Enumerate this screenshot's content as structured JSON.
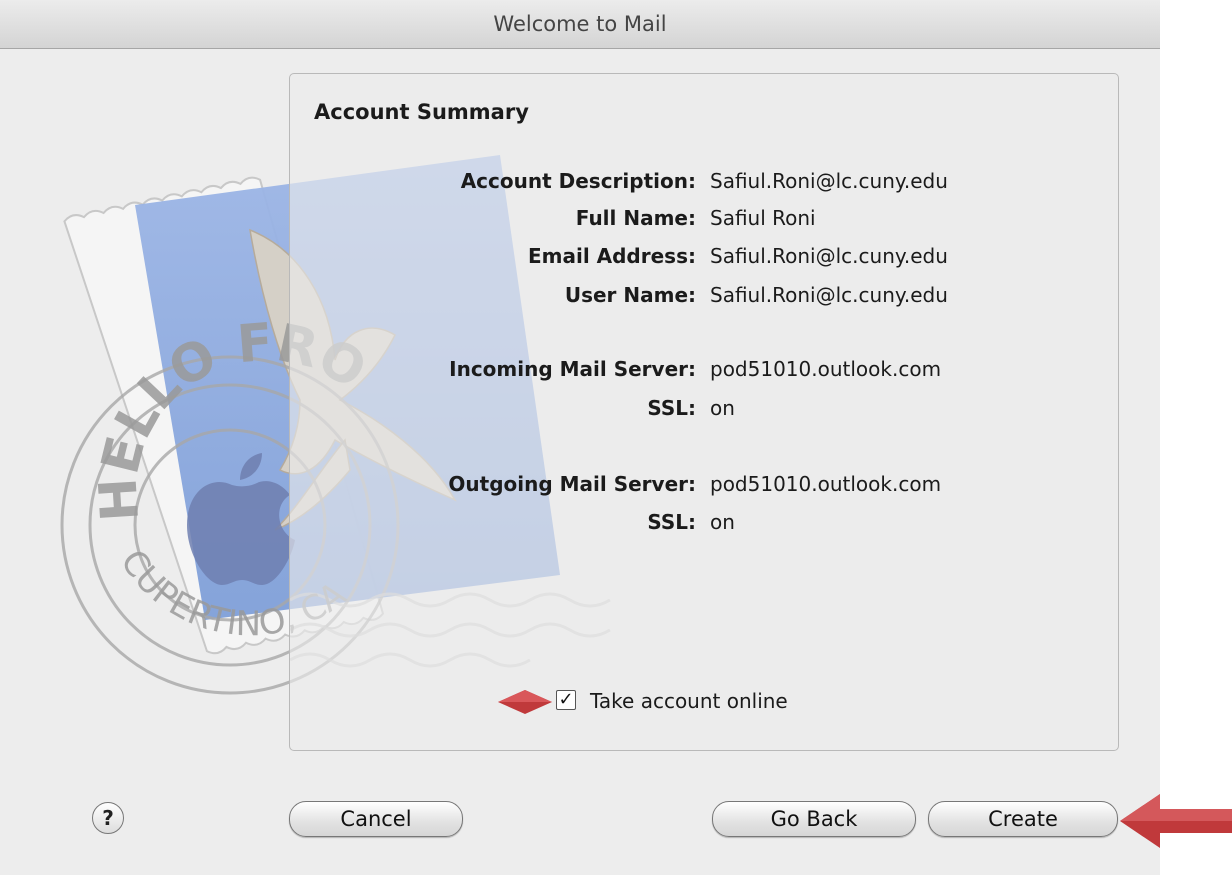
{
  "window": {
    "title": "Welcome to Mail"
  },
  "summary": {
    "title": "Account Summary",
    "rows": [
      {
        "label": "Account Description:",
        "value": "Safiul.Roni@lc.cuny.edu"
      },
      {
        "label": "Full Name:",
        "value": "Safiul Roni"
      },
      {
        "label": "Email Address:",
        "value": "Safiul.Roni@lc.cuny.edu"
      },
      {
        "label": "User Name:",
        "value": "Safiul.Roni@lc.cuny.edu"
      },
      {
        "label": "Incoming Mail Server:",
        "value": "pod51010.outlook.com"
      },
      {
        "label": "SSL:",
        "value": "on"
      },
      {
        "label": "Outgoing Mail Server:",
        "value": "pod51010.outlook.com"
      },
      {
        "label": "SSL:",
        "value": "on"
      }
    ]
  },
  "take_online": {
    "label": "Take account online",
    "checked": true,
    "check_glyph": "✓"
  },
  "stamp": {
    "top_text": "HELLO FROM",
    "bottom_text": "CUPERTINO, CA"
  },
  "buttons": {
    "help": "?",
    "cancel": "Cancel",
    "go_back": "Go Back",
    "create": "Create"
  },
  "colors": {
    "annotation_red": "#c0393b"
  },
  "icons": [
    "help-icon",
    "checkbox-checked-icon",
    "red-arrow-icon",
    "red-diamond-icon",
    "mail-stamp-icon"
  ]
}
